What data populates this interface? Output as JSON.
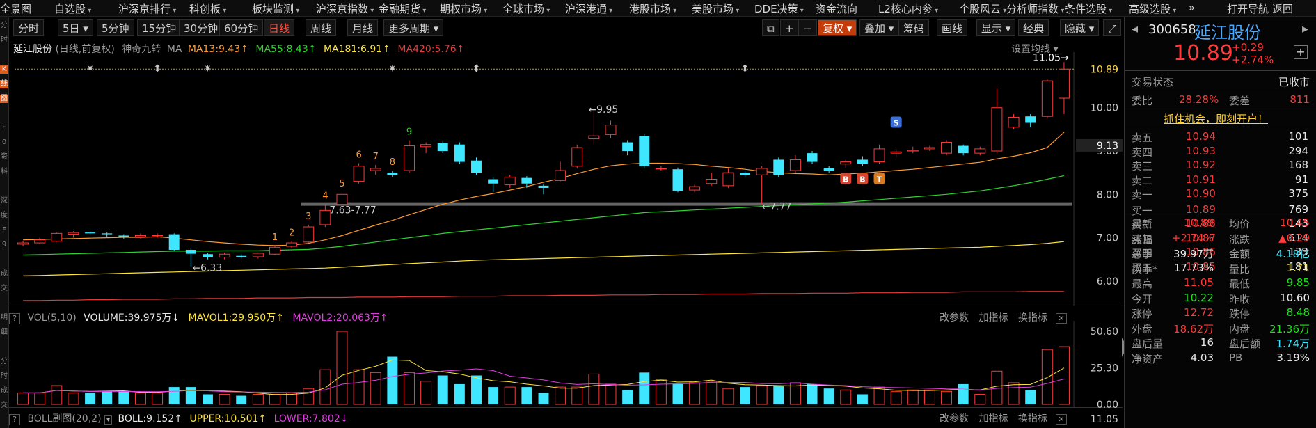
{
  "topmenu": [
    "全景图",
    "自选股",
    "沪深京排行",
    "科创板",
    "板块监测",
    "沪深京指数",
    "金融期货",
    "期权市场",
    "全球市场",
    "沪深港通",
    "港股市场",
    "美股市场",
    "DDE决策",
    "资金流向",
    "L2核心内参",
    "个股风云",
    "分析师指数",
    "条件选股",
    "高级选股",
    "»",
    "打开导航",
    "返回"
  ],
  "leftstrip": [
    "分",
    "时",
    "",
    "K",
    "线",
    "图",
    "",
    "F",
    "0",
    "资",
    "料",
    "",
    "深",
    "度",
    "F",
    "9",
    "",
    "成",
    "交",
    "",
    "明",
    "细",
    "",
    "分",
    "时",
    "成",
    "交"
  ],
  "toolbar": {
    "periods": [
      "分时",
      "5日",
      "5分钟",
      "15分钟",
      "30分钟",
      "60分钟",
      "日线",
      "周线",
      "月线",
      "更多周期"
    ],
    "active_period": "日线",
    "tools": [
      "复权",
      "叠加",
      "筹码",
      "画线",
      "显示",
      "经典",
      "隐藏"
    ]
  },
  "main_header": {
    "name": "延江股份",
    "mode": "(日线,前复权)",
    "indicator": "神奇九转",
    "ma": "MA",
    "ma13": "MA13:9.43",
    "ma55": "MA55:8.43",
    "ma181": "MA181:6.91",
    "ma420": "MA420:5.76",
    "settings": "设置均线"
  },
  "vol_header": {
    "label": "VOL(5,10)",
    "volume": "VOLUME:39.975万",
    "mavol1": "MAVOL1:29.950万",
    "mavol2": "MAVOL2:20.063万",
    "btn1": "改参数",
    "btn2": "加指标",
    "btn3": "换指标"
  },
  "boll_header": {
    "label": "BOLL副图(20,2)",
    "boll": "BOLL:9.152",
    "upper": "UPPER:10.501",
    "lower": "LOWER:7.802",
    "btn1": "改参数",
    "btn2": "加指标",
    "btn3": "换指标",
    "axis_top": "11.05"
  },
  "colors": {
    "up": "#ff3a3a",
    "down": "#3ee6ff",
    "ma13": "#ff9a2e",
    "ma55": "#2ed42e",
    "ma181": "#ffe63a",
    "ma420": "#e33a3a"
  },
  "chart_data": {
    "type": "candlestick",
    "price_ticks": [
      "10.00",
      "9.00",
      "8.00",
      "7.00",
      "6.00"
    ],
    "current_price_tag": "10.89",
    "price_marker": "9.13",
    "ylim": [
      5.5,
      11.2
    ],
    "annotations": {
      "high_label": "11.05→",
      "peak_label": "←9.95",
      "low_label": "←6.33",
      "range_label": "7.63-7.77",
      "support_label": "←7.77"
    },
    "nine_turn": [
      "1",
      "2",
      "3",
      "4",
      "5",
      "6",
      "7",
      "8",
      "9"
    ],
    "signal_badges": [
      "B",
      "B",
      "T",
      "S"
    ],
    "vol_ticks": [
      "50.60",
      "25.30",
      "0.00"
    ],
    "vol_ylim": [
      0,
      50.6
    ],
    "candles": [
      [
        6.85,
        6.88,
        6.8,
        6.92
      ],
      [
        6.88,
        6.95,
        6.85,
        7.0
      ],
      [
        6.92,
        7.1,
        6.9,
        7.12
      ],
      [
        7.08,
        7.12,
        7.0,
        7.15
      ],
      [
        7.12,
        7.1,
        7.05,
        7.15
      ],
      [
        7.1,
        7.08,
        7.02,
        7.12
      ],
      [
        7.05,
        7.02,
        6.98,
        7.08
      ],
      [
        7.02,
        7.05,
        6.98,
        7.1
      ],
      [
        7.05,
        7.06,
        7.0,
        7.1
      ],
      [
        7.08,
        6.72,
        6.7,
        7.1
      ],
      [
        6.72,
        6.63,
        6.33,
        6.75
      ],
      [
        6.62,
        6.55,
        6.5,
        6.65
      ],
      [
        6.55,
        6.62,
        6.5,
        6.66
      ],
      [
        6.58,
        6.56,
        6.52,
        6.62
      ],
      [
        6.56,
        6.64,
        6.52,
        6.66
      ],
      [
        6.62,
        6.78,
        6.6,
        6.82
      ],
      [
        6.8,
        6.88,
        6.75,
        6.92
      ],
      [
        6.9,
        7.25,
        6.88,
        7.3
      ],
      [
        7.3,
        7.63,
        7.25,
        7.77
      ],
      [
        7.77,
        8.0,
        7.7,
        8.05
      ],
      [
        8.3,
        8.65,
        8.25,
        8.72
      ],
      [
        8.55,
        8.6,
        8.45,
        8.68
      ],
      [
        8.5,
        8.45,
        8.4,
        8.55
      ],
      [
        8.55,
        9.12,
        8.5,
        9.25
      ],
      [
        9.1,
        9.15,
        8.95,
        9.2
      ],
      [
        9.18,
        9.0,
        8.95,
        9.22
      ],
      [
        9.15,
        8.75,
        8.7,
        9.2
      ],
      [
        8.78,
        8.5,
        8.45,
        8.85
      ],
      [
        8.35,
        8.25,
        8.05,
        8.4
      ],
      [
        8.22,
        8.4,
        8.15,
        8.45
      ],
      [
        8.38,
        8.25,
        8.15,
        8.42
      ],
      [
        8.2,
        8.15,
        8.0,
        8.25
      ],
      [
        8.32,
        8.55,
        8.3,
        8.75
      ],
      [
        8.65,
        9.08,
        8.6,
        9.15
      ],
      [
        9.28,
        9.35,
        9.15,
        9.95
      ],
      [
        9.38,
        9.6,
        9.3,
        9.7
      ],
      [
        9.2,
        9.0,
        8.9,
        9.25
      ],
      [
        9.35,
        8.65,
        8.6,
        9.4
      ],
      [
        8.6,
        8.6,
        8.55,
        8.65
      ],
      [
        8.58,
        8.08,
        8.05,
        8.62
      ],
      [
        8.1,
        8.18,
        8.05,
        8.22
      ],
      [
        8.25,
        8.35,
        8.2,
        8.5
      ],
      [
        8.2,
        8.5,
        8.15,
        8.6
      ],
      [
        8.5,
        8.45,
        8.4,
        8.55
      ],
      [
        8.45,
        8.6,
        7.77,
        8.65
      ],
      [
        8.8,
        8.45,
        8.4,
        8.85
      ],
      [
        8.55,
        8.8,
        8.5,
        8.9
      ],
      [
        8.95,
        8.75,
        8.7,
        9.0
      ],
      [
        8.6,
        8.55,
        8.5,
        8.65
      ],
      [
        8.7,
        8.75,
        8.6,
        8.8
      ],
      [
        8.8,
        8.7,
        8.65,
        8.88
      ],
      [
        8.75,
        9.05,
        8.7,
        9.15
      ],
      [
        8.95,
        8.98,
        8.85,
        9.05
      ],
      [
        9.0,
        9.02,
        8.95,
        9.1
      ],
      [
        9.05,
        9.08,
        9.0,
        9.12
      ],
      [
        8.95,
        9.2,
        8.9,
        9.25
      ],
      [
        9.12,
        8.95,
        8.9,
        9.15
      ],
      [
        8.95,
        9.05,
        8.9,
        9.1
      ],
      [
        9.0,
        10.0,
        8.95,
        10.45
      ],
      [
        9.55,
        9.78,
        9.5,
        9.85
      ],
      [
        9.8,
        9.65,
        9.55,
        9.85
      ],
      [
        9.8,
        10.62,
        9.75,
        10.65
      ],
      [
        10.22,
        10.89,
        9.85,
        11.05
      ]
    ],
    "volumes": [
      8,
      8,
      13,
      8,
      8,
      9,
      9,
      8,
      8,
      12,
      12,
      7,
      7,
      6,
      7,
      7,
      8,
      11,
      24,
      50.6,
      24,
      22,
      33,
      22,
      16,
      20,
      14,
      20,
      12,
      12,
      12,
      8,
      12,
      12,
      21,
      14,
      10,
      22,
      17,
      14,
      15,
      16,
      11,
      12,
      13,
      13,
      15,
      14,
      11,
      10,
      7,
      12,
      9,
      10,
      10,
      9,
      14,
      7,
      23,
      15,
      10,
      38,
      39.975
    ],
    "ma13": [
      6.95,
      6.96,
      6.97,
      6.98,
      6.99,
      7.0,
      7.01,
      7.01,
      7.02,
      6.99,
      6.95,
      6.91,
      6.88,
      6.85,
      6.83,
      6.82,
      6.83,
      6.87,
      6.95,
      7.05,
      7.17,
      7.29,
      7.4,
      7.53,
      7.65,
      7.77,
      7.87,
      7.95,
      8.02,
      8.1,
      8.18,
      8.28,
      8.37,
      8.48,
      8.58,
      8.66,
      8.7,
      8.72,
      8.72,
      8.71,
      8.69,
      8.65,
      8.62,
      8.58,
      8.53,
      8.5,
      8.48,
      8.47,
      8.45,
      8.47,
      8.49,
      8.52,
      8.55,
      8.58,
      8.62,
      8.66,
      8.7,
      8.74,
      8.82,
      8.88,
      8.96,
      9.08,
      9.43
    ],
    "ma55": [
      6.6,
      6.61,
      6.62,
      6.63,
      6.64,
      6.65,
      6.66,
      6.67,
      6.68,
      6.69,
      6.69,
      6.69,
      6.7,
      6.7,
      6.7,
      6.71,
      6.72,
      6.73,
      6.76,
      6.8,
      6.85,
      6.9,
      6.95,
      7.0,
      7.05,
      7.1,
      7.14,
      7.18,
      7.22,
      7.26,
      7.3,
      7.34,
      7.38,
      7.42,
      7.46,
      7.5,
      7.54,
      7.58,
      7.6,
      7.62,
      7.64,
      7.66,
      7.68,
      7.7,
      7.72,
      7.74,
      7.76,
      7.78,
      7.8,
      7.82,
      7.85,
      7.88,
      7.91,
      7.94,
      7.97,
      8.0,
      8.04,
      8.08,
      8.14,
      8.2,
      8.27,
      8.35,
      8.43
    ],
    "ma181": [
      6.12,
      6.13,
      6.14,
      6.15,
      6.16,
      6.17,
      6.18,
      6.19,
      6.2,
      6.21,
      6.22,
      6.23,
      6.24,
      6.25,
      6.26,
      6.27,
      6.28,
      6.29,
      6.3,
      6.32,
      6.34,
      6.36,
      6.38,
      6.4,
      6.42,
      6.44,
      6.46,
      6.48,
      6.49,
      6.5,
      6.51,
      6.52,
      6.53,
      6.54,
      6.55,
      6.56,
      6.57,
      6.58,
      6.59,
      6.6,
      6.61,
      6.62,
      6.63,
      6.64,
      6.65,
      6.66,
      6.67,
      6.68,
      6.69,
      6.7,
      6.71,
      6.72,
      6.73,
      6.74,
      6.75,
      6.76,
      6.77,
      6.78,
      6.8,
      6.82,
      6.84,
      6.87,
      6.91
    ],
    "ma420": [
      5.55,
      5.55,
      5.56,
      5.56,
      5.57,
      5.57,
      5.58,
      5.58,
      5.58,
      5.59,
      5.59,
      5.6,
      5.6,
      5.6,
      5.61,
      5.61,
      5.61,
      5.62,
      5.62,
      5.62,
      5.63,
      5.63,
      5.63,
      5.64,
      5.64,
      5.64,
      5.65,
      5.65,
      5.65,
      5.66,
      5.66,
      5.66,
      5.67,
      5.67,
      5.67,
      5.68,
      5.68,
      5.68,
      5.69,
      5.69,
      5.69,
      5.7,
      5.7,
      5.7,
      5.71,
      5.71,
      5.71,
      5.72,
      5.72,
      5.72,
      5.73,
      5.73,
      5.73,
      5.74,
      5.74,
      5.74,
      5.75,
      5.75,
      5.75,
      5.75,
      5.76,
      5.76,
      5.76
    ]
  },
  "quote": {
    "code": "300658",
    "name": "延江股份",
    "price": "10.89",
    "change": "+0.29",
    "pct": "+2.74%",
    "status_label": "交易状态",
    "status": "已收市",
    "weibi_label": "委比",
    "weibi": "28.28%",
    "weicha_label": "委差",
    "weicha": "811",
    "promo": "抓住机会，即刻开户！",
    "asks": [
      {
        "label": "卖五",
        "price": "10.94",
        "vol": "101"
      },
      {
        "label": "卖四",
        "price": "10.93",
        "vol": "294"
      },
      {
        "label": "卖三",
        "price": "10.92",
        "vol": "168"
      },
      {
        "label": "卖二",
        "price": "10.91",
        "vol": "91"
      },
      {
        "label": "卖一",
        "price": "10.90",
        "vol": "375"
      }
    ],
    "bids": [
      {
        "label": "买一",
        "price": "10.89",
        "vol": "769"
      },
      {
        "label": "买二",
        "price": "10.88",
        "vol": "143"
      },
      {
        "label": "买三",
        "price": "10.87",
        "vol": "614"
      },
      {
        "label": "买四",
        "price": "10.86",
        "vol": "133"
      },
      {
        "label": "买五",
        "price": "10.85",
        "vol": "181"
      }
    ],
    "stats": [
      {
        "l1": "最新",
        "v1": "10.89",
        "c1": "red",
        "l2": "均价",
        "v2": "10.45",
        "c2": "red"
      },
      {
        "l1": "涨幅",
        "v1": "+2.74%",
        "c1": "red",
        "l2": "涨跌",
        "v2": "▲0.29",
        "c2": "red"
      },
      {
        "l1": "总手",
        "v1": "39.97万",
        "c1": "white",
        "l2": "金额",
        "v2": "4.18亿",
        "c2": "cyan"
      },
      {
        "l1": "换手*",
        "v1": "17.73%",
        "c1": "white",
        "l2": "量比",
        "v2": "1.71",
        "c2": "yellow"
      },
      {
        "l1": "最高",
        "v1": "11.05",
        "c1": "red",
        "l2": "最低",
        "v2": "9.85",
        "c2": "green"
      },
      {
        "l1": "今开",
        "v1": "10.22",
        "c1": "green",
        "l2": "昨收",
        "v2": "10.60",
        "c2": "white"
      },
      {
        "l1": "涨停",
        "v1": "12.72",
        "c1": "red",
        "l2": "跌停",
        "v2": "8.48",
        "c2": "green"
      },
      {
        "l1": "外盘",
        "v1": "18.62万",
        "c1": "red",
        "l2": "内盘",
        "v2": "21.36万",
        "c2": "green"
      },
      {
        "l1": "盘后量",
        "v1": "16",
        "c1": "white",
        "l2": "盘后额",
        "v2": "1.74万",
        "c2": "cyan"
      },
      {
        "l1": "净资产",
        "v1": "4.03",
        "c1": "white",
        "l2": "PB",
        "v2": "3.19%",
        "c2": "white"
      }
    ]
  }
}
